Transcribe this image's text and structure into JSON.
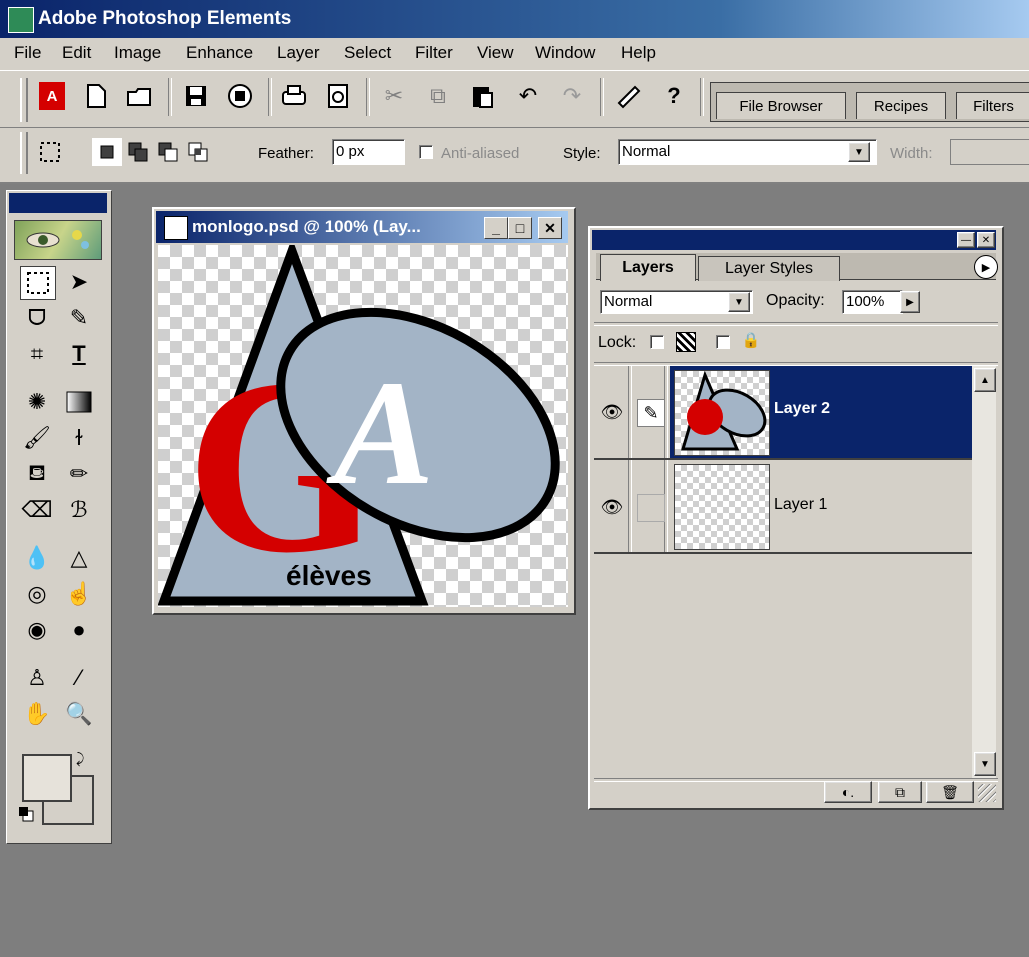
{
  "app": {
    "title": "Adobe Photoshop Elements"
  },
  "menu": [
    "File",
    "Edit",
    "Image",
    "Enhance",
    "Layer",
    "Select",
    "Filter",
    "View",
    "Window",
    "Help"
  ],
  "toolbar": {
    "icons": [
      "adobe-logo-icon",
      "new-file-icon",
      "open-file-icon",
      "save-icon",
      "save-for-web-icon",
      "print-icon",
      "print-preview-icon",
      "cut-icon",
      "copy-icon",
      "paste-icon",
      "undo-icon",
      "redo-icon",
      "step-backward-icon",
      "help-icon"
    ],
    "tabs": [
      "File Browser",
      "Recipes",
      "Filters"
    ]
  },
  "options": {
    "feather_label": "Feather:",
    "feather_value": "0 px",
    "anti_aliased_label": "Anti-aliased",
    "style_label": "Style:",
    "style_value": "Normal",
    "width_label": "Width:"
  },
  "document": {
    "title": "monlogo.psd @ 100% (Lay...",
    "logo_letters": {
      "g": "G",
      "a": "A"
    },
    "logo_text": "élèves"
  },
  "layers_panel": {
    "tabs": [
      "Layers",
      "Layer Styles"
    ],
    "blend_mode": "Normal",
    "opacity_label": "Opacity:",
    "opacity_value": "100%",
    "lock_label": "Lock:",
    "layers": [
      {
        "name": "Layer 2",
        "selected": true
      },
      {
        "name": "Layer 1",
        "selected": false
      }
    ]
  },
  "colors": {
    "titlebar": "#0a246a",
    "selection": "#0a246a",
    "logo_red": "#d40000",
    "logo_fill": "#a3b4c6"
  }
}
